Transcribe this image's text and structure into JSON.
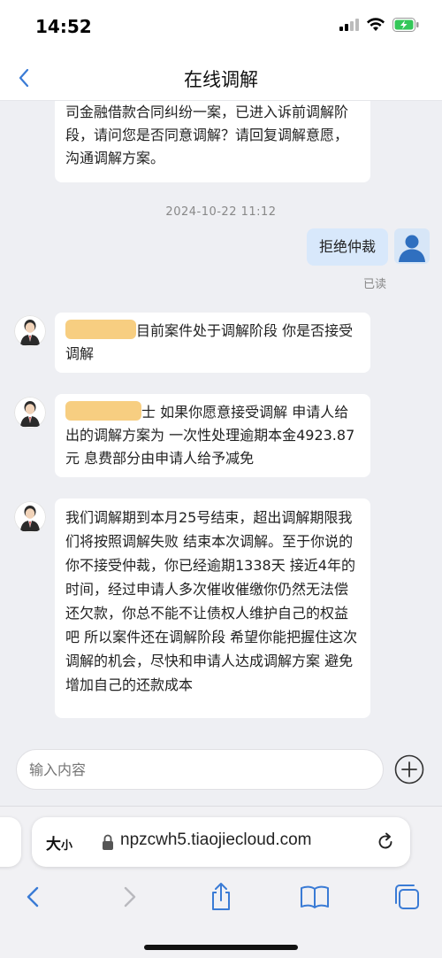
{
  "status": {
    "time": "14:52"
  },
  "nav": {
    "title": "在线调解"
  },
  "chat": {
    "first_message": "司金融借款合同纠纷一案，已进入诉前调解阶段，请问您是否同意调解？请回复调解意愿，沟通调解方案。",
    "timestamp": "2024-10-22 11:12",
    "my_message": "拒绝仲裁",
    "read_label": "已读",
    "agent_msg_1": "目前案件处于调解阶段 你是否接受调解",
    "agent_msg_2_tail": "士",
    "agent_msg_2": "如果你愿意接受调解 申请人给出的调解方案为 一次性处理逾期本金4923.87元 息费部分由申请人给予减免",
    "agent_msg_3": "我们调解期到本月25号结束，超出调解期限我们将按照调解失败 结束本次调解。至于你说的你不接受仲裁，你已经逾期1338天 接近4年的时间，经过申请人多次催收催缴你仍然无法偿还欠款，你总不能不让债权人维护自己的权益吧 所以案件还在调解阶段 希望你能把握住这次调解的机会，尽快和申请人达成调解方案 避免增加自己的还款成本"
  },
  "input": {
    "placeholder": "输入内容"
  },
  "browser": {
    "aa_big": "大",
    "aa_small": "小",
    "url": "npzcwh5.tiaojiecloud.com"
  },
  "colors": {
    "accent": "#3a7bd5",
    "my_bubble": "#d8e8fb",
    "background": "#eeeff3"
  }
}
